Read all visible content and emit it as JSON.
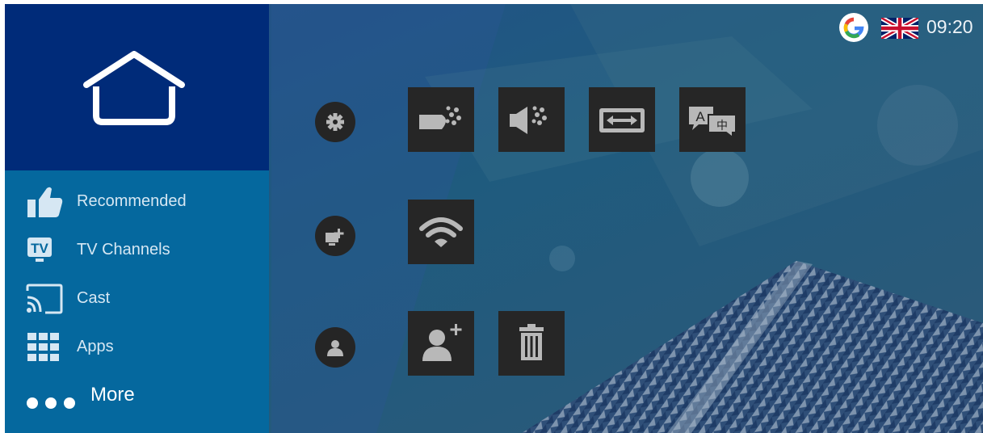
{
  "sidebar": {
    "home_icon": "home-icon",
    "items": [
      {
        "label": "Recommended",
        "icon": "thumbs-up-icon"
      },
      {
        "label": "TV Channels",
        "icon": "tv-badge-icon",
        "badge": "TV"
      },
      {
        "label": "Cast",
        "icon": "cast-icon"
      },
      {
        "label": "Apps",
        "icon": "apps-grid-icon"
      },
      {
        "label": "More",
        "icon": "more-dots-icon"
      }
    ]
  },
  "status_bar": {
    "account_icon": "google-g-icon",
    "language_flag": "uk-flag-icon",
    "time": "09:20"
  },
  "settings": {
    "rows": [
      {
        "category_icon": "gear-icon",
        "tiles": [
          "picture-settings-icon",
          "sound-settings-icon",
          "aspect-ratio-icon",
          "language-icon"
        ]
      },
      {
        "category_icon": "device-add-icon",
        "tiles": [
          "wifi-icon"
        ]
      },
      {
        "category_icon": "user-icon",
        "tiles": [
          "add-user-icon",
          "trash-icon"
        ]
      }
    ],
    "language_tile_glyphs": {
      "latin": "A",
      "chinese": "中"
    }
  },
  "colors": {
    "sidebar_top": "#002b79",
    "sidebar": "#05689e",
    "tile": "#262626",
    "icon": "#b8b8b8"
  }
}
